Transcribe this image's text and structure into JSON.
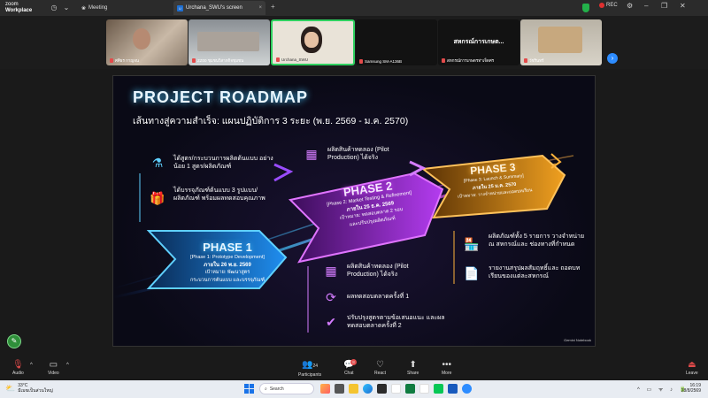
{
  "titlebar": {
    "app_name_line1": "zoom",
    "app_name_line2": "Workplace",
    "meeting_label": "Meeting",
    "tab_label": "Urchana_SWU's screen",
    "tab_badge": "U",
    "rec_label": "REC"
  },
  "participants_strip": [
    {
      "name": "ศศิธร กาญจน"
    },
    {
      "name": "ZZ00 ชุมชนวิสาหกิจชุมชน"
    },
    {
      "name": "Urchana_SWU"
    },
    {
      "name": "Samsung SM-A136B"
    },
    {
      "name": "สหกรณ์การเกษตรท่าเจ็ดศร"
    },
    {
      "name": "วัชรินทร์"
    }
  ],
  "strip_center_text": "สหกรณ์การเกษต...",
  "slide": {
    "title": "PROJECT ROADMAP",
    "subtitle": "เส้นทางสู่ความสำเร็จ: แผนปฏิบัติการ 3 ระยะ (พ.ย. 2569 - ม.ค. 2570)",
    "phase1": {
      "label": "PHASE 1",
      "sub": "[Phase 1: Prototype Development]",
      "deadline": "ภายใน 26 พ.ย. 2569",
      "goal": "เป้าหมาย: พัฒนาสูตร",
      "goal2": "กระบวนการต้นแบบ และบรรจุภัณฑ์",
      "items": [
        "ได้สูตร/กระบวนการผลิตต้นแบบ อย่างน้อย 1 สูตร/ผลิตภัณฑ์",
        "ได้บรรจุภัณฑ์ต้นแบบ 3 รูปแบบ/ผลิตภัณฑ์ พร้อมผลทดสอบคุณภาพ"
      ]
    },
    "phase2": {
      "label": "PHASE 2",
      "sub": "[Phase 2: Market Testing & Refinement]",
      "deadline": "ภายใน 25 ธ.ค. 2569",
      "goal": "เป้าหมาย: ทดสอบตลาด 2 รอบ",
      "goal2": "และปรับปรุงผลิตภัณฑ์",
      "top_item": "ผลิตสินค้าทดลอง (Pilot Production) ได้จริง",
      "items": [
        "ผลิตสินค้าทดลอง (Pilot Production) ได้จริง",
        "ผลทดสอบตลาดครั้งที่ 1",
        "ปรับปรุงสูตรตามข้อเสนอแนะ และผลทดสอบตลาดครั้งที่ 2"
      ]
    },
    "phase3": {
      "label": "PHASE 3",
      "sub": "[Phase 3: Launch & Summary]",
      "deadline": "ภายใน 25 ม.ค. 2570",
      "goal": "เป้าหมาย: วางจำหน่ายและถอดบทเรียน",
      "items": [
        "ผลิตภัณฑ์ทั้ง 5 รายการ วางจำหน่าย ณ สหกรณ์และ ช่องทางที่กำหนด",
        "รายงานสรุปผลสัมฤทธิ์และ ถอดบทเรียนของแต่ละสหกรณ์"
      ]
    },
    "watermark": "Gemini Notebook"
  },
  "controls": {
    "audio": "Audio",
    "video": "Video",
    "participants": "Participants",
    "participants_count": "24",
    "chat": "Chat",
    "chat_badge": "8",
    "react": "React",
    "share": "Share",
    "more": "More",
    "leave": "Leave"
  },
  "taskbar": {
    "weather_temp": "33°C",
    "weather_desc": "มีเมฆเป็นส่วนใหญ่",
    "search_placeholder": "Search",
    "time": "16:19",
    "date": "28/8/2569"
  }
}
